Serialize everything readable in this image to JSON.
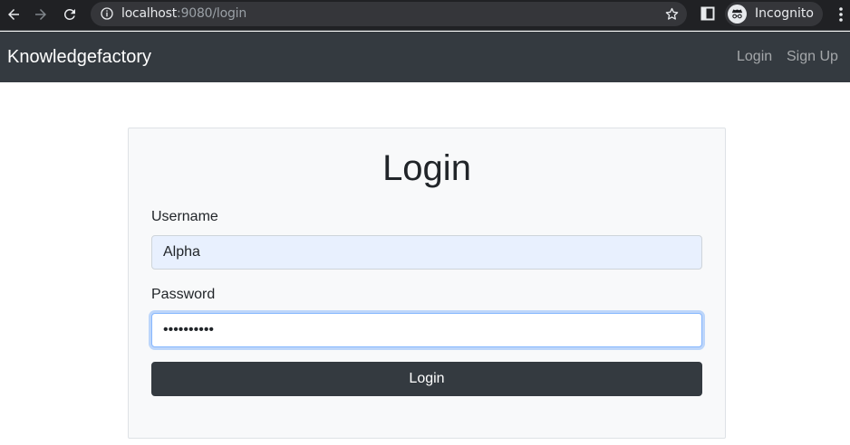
{
  "browser": {
    "url_host": "localhost",
    "url_rest": ":9080/login",
    "profile_label": "Incognito",
    "icons": [
      "back-arrow-icon",
      "forward-arrow-icon",
      "reload-icon",
      "info-icon",
      "star-icon",
      "side-panel-icon",
      "incognito-icon",
      "more-vert-icon"
    ]
  },
  "navbar": {
    "brand": "Knowledgefactory",
    "links": [
      {
        "label": "Login"
      },
      {
        "label": "Sign Up"
      }
    ],
    "background": "#343a40"
  },
  "login_form": {
    "title": "Login",
    "username_label": "Username",
    "username_value": "Alpha",
    "password_label": "Password",
    "password_value": "••••••••••",
    "submit_label": "Login"
  },
  "colors": {
    "accent": "#343a40",
    "autofill": "#e8f0fe",
    "focus_ring": "#86b7fe"
  }
}
